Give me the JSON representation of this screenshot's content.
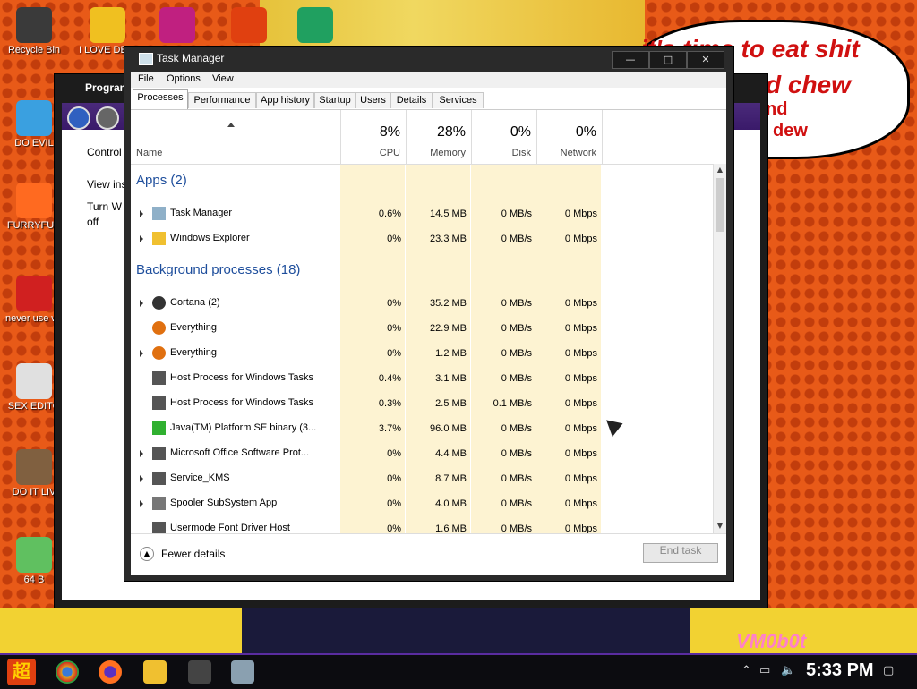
{
  "desktop": {
    "speech_bubble": [
      "it's time to eat shit",
      "d chew",
      "nd",
      "dew"
    ],
    "watermark": "VM0b0t",
    "icons": [
      {
        "label": "Recycle Bin",
        "color": "#3a3a3a"
      },
      {
        "label": "I LOVE DETECTING",
        "color": "#f0c020"
      },
      {
        "label": "",
        "color": "#c02080"
      },
      {
        "label": "",
        "color": "#e04010"
      },
      {
        "label": "",
        "color": "#20a060"
      },
      {
        "label": "DO EVIL",
        "color": "#3aa0e0"
      },
      {
        "label": "FURRYFUC",
        "color": "#ff6a20"
      },
      {
        "label": "never use why is it",
        "color": "#d02020"
      },
      {
        "label": "SEX EDITO",
        "color": "#e0e0e0"
      },
      {
        "label": "DO IT LIV",
        "color": "#806040"
      },
      {
        "label": "64 B",
        "color": "#60c060"
      }
    ]
  },
  "background_window": {
    "title": "Program",
    "text": [
      "Control",
      "View ins",
      "Turn W",
      "off"
    ]
  },
  "task_manager": {
    "title": "Task Manager",
    "window_buttons": {
      "minimize": "—",
      "maximize": "□",
      "close": "✕"
    },
    "menu": [
      "File",
      "Options",
      "View"
    ],
    "tabs": [
      "Processes",
      "Performance",
      "App history",
      "Startup",
      "Users",
      "Details",
      "Services"
    ],
    "active_tab": "Processes",
    "columns": {
      "name": "Name",
      "cpu": {
        "percent": "8%",
        "label": "CPU"
      },
      "memory": {
        "percent": "28%",
        "label": "Memory"
      },
      "disk": {
        "percent": "0%",
        "label": "Disk"
      },
      "network": {
        "percent": "0%",
        "label": "Network"
      }
    },
    "groups": [
      {
        "title": "Apps (2)",
        "rows": [
          {
            "name": "Task Manager",
            "expandable": true,
            "icon": "task-manager-icon",
            "cpu": "0.6%",
            "memory": "14.5 MB",
            "disk": "0 MB/s",
            "network": "0 Mbps"
          },
          {
            "name": "Windows Explorer",
            "expandable": true,
            "icon": "explorer-icon",
            "cpu": "0%",
            "memory": "23.3 MB",
            "disk": "0 MB/s",
            "network": "0 Mbps"
          }
        ]
      },
      {
        "title": "Background processes (18)",
        "rows": [
          {
            "name": "Cortana (2)",
            "expandable": true,
            "icon": "cortana-icon",
            "cpu": "0%",
            "memory": "35.2 MB",
            "disk": "0 MB/s",
            "network": "0 Mbps"
          },
          {
            "name": "Everything",
            "expandable": false,
            "icon": "everything-icon",
            "cpu": "0%",
            "memory": "22.9 MB",
            "disk": "0 MB/s",
            "network": "0 Mbps"
          },
          {
            "name": "Everything",
            "expandable": true,
            "icon": "everything-icon",
            "cpu": "0%",
            "memory": "1.2 MB",
            "disk": "0 MB/s",
            "network": "0 Mbps"
          },
          {
            "name": "Host Process for Windows Tasks",
            "expandable": false,
            "icon": "process-icon",
            "cpu": "0.4%",
            "memory": "3.1 MB",
            "disk": "0 MB/s",
            "network": "0 Mbps"
          },
          {
            "name": "Host Process for Windows Tasks",
            "expandable": false,
            "icon": "process-icon",
            "cpu": "0.3%",
            "memory": "2.5 MB",
            "disk": "0.1 MB/s",
            "network": "0 Mbps"
          },
          {
            "name": "Java(TM) Platform SE binary (3...",
            "expandable": false,
            "icon": "java-icon",
            "cpu": "3.7%",
            "memory": "96.0 MB",
            "disk": "0 MB/s",
            "network": "0 Mbps"
          },
          {
            "name": "Microsoft Office Software Prot...",
            "expandable": true,
            "icon": "process-icon",
            "cpu": "0%",
            "memory": "4.4 MB",
            "disk": "0 MB/s",
            "network": "0 Mbps"
          },
          {
            "name": "Service_KMS",
            "expandable": true,
            "icon": "process-icon",
            "cpu": "0%",
            "memory": "8.7 MB",
            "disk": "0 MB/s",
            "network": "0 Mbps"
          },
          {
            "name": "Spooler SubSystem App",
            "expandable": true,
            "icon": "printer-icon",
            "cpu": "0%",
            "memory": "4.0 MB",
            "disk": "0 MB/s",
            "network": "0 Mbps"
          },
          {
            "name": "Usermode Font Driver Host",
            "expandable": false,
            "icon": "process-icon",
            "cpu": "0%",
            "memory": "1.6 MB",
            "disk": "0 MB/s",
            "network": "0 Mbps"
          }
        ]
      }
    ],
    "footer": {
      "fewer_details": "Fewer details",
      "end_task": "End task"
    }
  },
  "taskbar": {
    "start_glyph": "超",
    "clock": "5:33 PM"
  }
}
